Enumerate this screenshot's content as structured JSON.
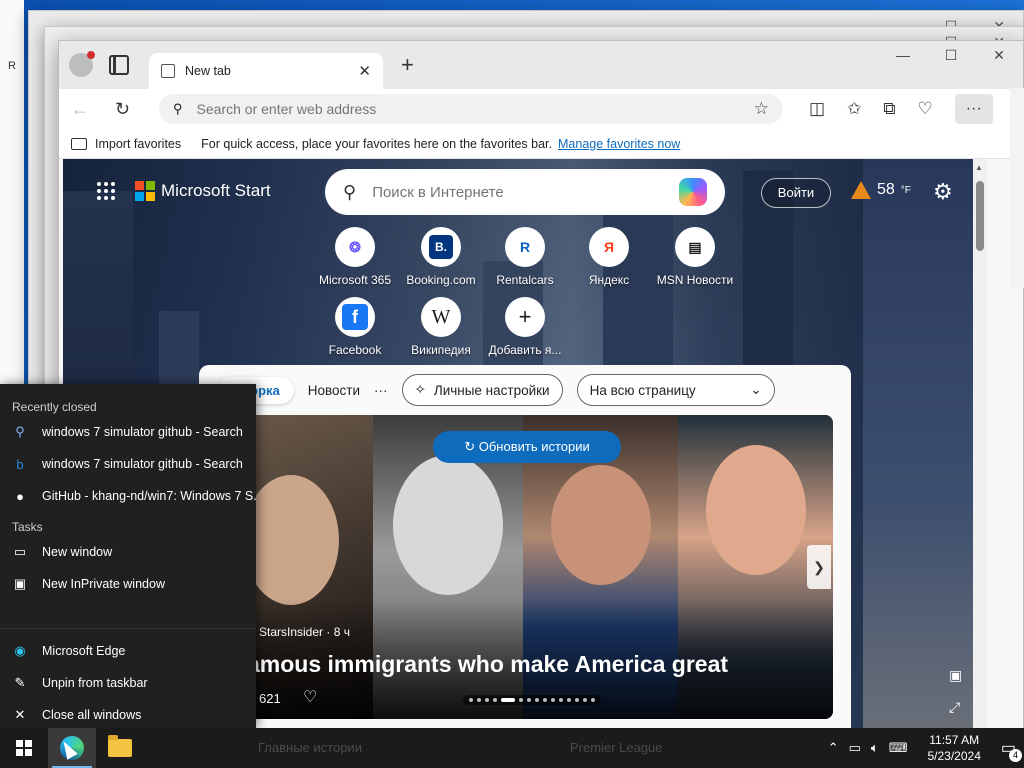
{
  "browser": {
    "tab_title": "New tab",
    "address_placeholder": "Search or enter web address",
    "favorites_bar": {
      "import_label": "Import favorites",
      "hint": "For quick access, place your favorites here on the favorites bar.",
      "manage_link": "Manage favorites now"
    }
  },
  "ntp": {
    "brand": "Microsoft Start",
    "search_placeholder": "Поиск в Интернете",
    "login_label": "Войти",
    "weather_temp": "58",
    "weather_unit": "°F",
    "quick_links": [
      {
        "label": "Microsoft 365",
        "icon": "microsoft-365-icon"
      },
      {
        "label": "Booking.com",
        "icon": "booking-icon"
      },
      {
        "label": "Rentalcars",
        "icon": "rentalcars-icon"
      },
      {
        "label": "Яндекс",
        "icon": "yandex-icon"
      },
      {
        "label": "MSN Новости",
        "icon": "msn-news-icon"
      },
      {
        "label": "Facebook",
        "icon": "facebook-icon"
      },
      {
        "label": "Википедия",
        "icon": "wikipedia-icon"
      },
      {
        "label": "Добавить я...",
        "icon": "add-icon"
      }
    ],
    "feed": {
      "tabs": [
        "ыборка",
        "Новости"
      ],
      "more": "···",
      "personalize_label": "Личные настройки",
      "layout_select": "На всю страницу",
      "refresh_label": "Обновить истории",
      "source": "StarsInsider · 8 ч",
      "headline": "amous immigrants who make America great",
      "likes": "621"
    }
  },
  "jumplist": {
    "recent_header": "Recently closed",
    "recent": [
      {
        "label": "windows 7 simulator github - Search",
        "icon": "search-icon"
      },
      {
        "label": "windows 7 simulator github - Search",
        "icon": "bing-icon"
      },
      {
        "label": "GitHub - khang-nd/win7: Windows 7 S...",
        "icon": "github-icon"
      }
    ],
    "tasks_header": "Tasks",
    "tasks": [
      {
        "label": "New window",
        "icon": "window-icon"
      },
      {
        "label": "New InPrivate window",
        "icon": "inprivate-icon"
      }
    ],
    "app": [
      {
        "label": "Microsoft Edge",
        "icon": "edge-icon"
      },
      {
        "label": "Unpin from taskbar",
        "icon": "unpin-icon"
      },
      {
        "label": "Close all windows",
        "icon": "close-icon"
      }
    ]
  },
  "taskbar": {
    "ghost_1": "Главные истории",
    "ghost_2": "Premier League",
    "time": "11:57 AM",
    "date": "5/23/2024",
    "notifications": "4"
  },
  "colors": {
    "accent": "#0f6cbd",
    "taskbar": "#1b1b1b",
    "jumplist": "#202020"
  }
}
